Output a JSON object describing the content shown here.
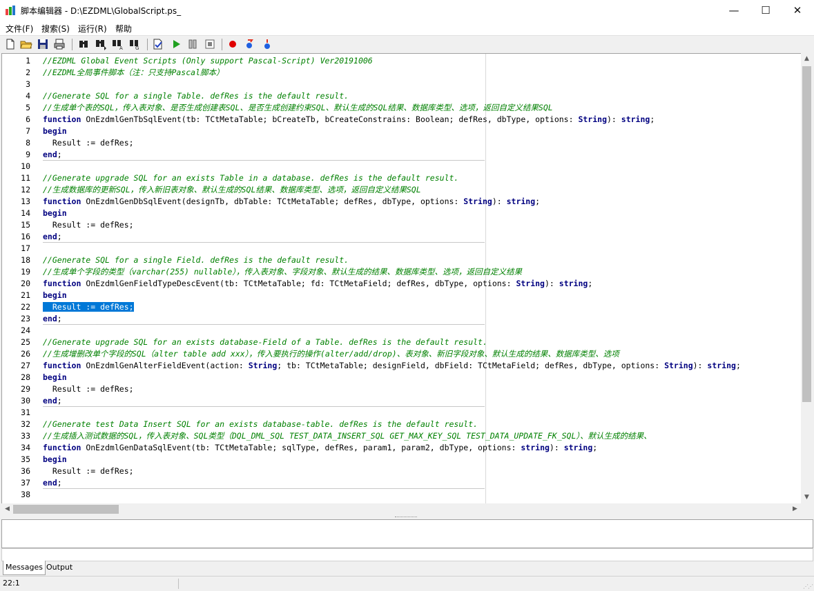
{
  "window": {
    "title": "脚本编辑器 - D:\\EZDML\\GlobalScript.ps_",
    "minimize_glyph": "—",
    "maximize_glyph": "☐",
    "close_glyph": "✕"
  },
  "menu": {
    "items": [
      {
        "label": "文件(F)"
      },
      {
        "label": "搜索(S)"
      },
      {
        "label": "运行(R)"
      },
      {
        "label": "帮助"
      }
    ]
  },
  "toolbar": {
    "buttons": [
      "new-file-icon",
      "open-folder-icon",
      "save-icon",
      "print-preview-icon",
      "find-icon",
      "find-next-icon",
      "replace-icon",
      "goto-line-icon",
      "syntax-check-icon",
      "run-icon",
      "pause-icon",
      "step-icon",
      "breakpoint-icon",
      "step-into-icon",
      "step-over-icon"
    ]
  },
  "editor": {
    "selected_line": 22,
    "lines": [
      {
        "n": "1",
        "segs": [
          {
            "t": "//EZDML Global Event Scripts (Only support Pascal-Script) Ver20191006",
            "c": "cmt"
          }
        ]
      },
      {
        "n": "2",
        "segs": [
          {
            "t": "//EZDML全局事件脚本（注：只支持Pascal脚本）",
            "c": "cmt"
          }
        ]
      },
      {
        "n": "3",
        "segs": []
      },
      {
        "n": "4",
        "segs": [
          {
            "t": "//Generate SQL for a single Table. defRes is the default result.",
            "c": "cmt"
          }
        ]
      },
      {
        "n": "5",
        "segs": [
          {
            "t": "//生成单个表的SQL，传入表对象、是否生成创建表SQL、是否生成创建约束SQL、默认生成的SQL结果、数据库类型、选项，返回自定义结果SQL",
            "c": "cmt"
          }
        ]
      },
      {
        "n": "6",
        "segs": [
          {
            "t": "function",
            "c": "kw"
          },
          {
            "t": " OnEzdmlGenTbSqlEvent(tb: TCtMetaTable; bCreateTb, bCreateConstrains: Boolean; defRes, dbType, options: ",
            "c": ""
          },
          {
            "t": "String",
            "c": "kw"
          },
          {
            "t": "): ",
            "c": ""
          },
          {
            "t": "string",
            "c": "kw"
          },
          {
            "t": ";",
            "c": ""
          }
        ]
      },
      {
        "n": "7",
        "segs": [
          {
            "t": "begin",
            "c": "kw"
          }
        ]
      },
      {
        "n": "8",
        "segs": [
          {
            "t": "  Result := defRes;",
            "c": ""
          }
        ]
      },
      {
        "n": "9",
        "segs": [
          {
            "t": "end",
            "c": "kw"
          },
          {
            "t": ";",
            "c": ""
          }
        ]
      },
      {
        "n": "10",
        "segs": []
      },
      {
        "n": "11",
        "segs": [
          {
            "t": "//Generate upgrade SQL for an exists Table in a database. defRes is the default result.",
            "c": "cmt"
          }
        ]
      },
      {
        "n": "12",
        "segs": [
          {
            "t": "//生成数据库的更新SQL，传入新旧表对象、默认生成的SQL结果、数据库类型、选项，返回自定义结果SQL",
            "c": "cmt"
          }
        ]
      },
      {
        "n": "13",
        "segs": [
          {
            "t": "function",
            "c": "kw"
          },
          {
            "t": " OnEzdmlGenDbSqlEvent(designTb, dbTable: TCtMetaTable; defRes, dbType, options: ",
            "c": ""
          },
          {
            "t": "String",
            "c": "kw"
          },
          {
            "t": "): ",
            "c": ""
          },
          {
            "t": "string",
            "c": "kw"
          },
          {
            "t": ";",
            "c": ""
          }
        ]
      },
      {
        "n": "14",
        "segs": [
          {
            "t": "begin",
            "c": "kw"
          }
        ]
      },
      {
        "n": "15",
        "segs": [
          {
            "t": "  Result := defRes;",
            "c": ""
          }
        ]
      },
      {
        "n": "16",
        "segs": [
          {
            "t": "end",
            "c": "kw"
          },
          {
            "t": ";",
            "c": ""
          }
        ]
      },
      {
        "n": "17",
        "segs": []
      },
      {
        "n": "18",
        "segs": [
          {
            "t": "//Generate SQL for a single Field. defRes is the default result.",
            "c": "cmt"
          }
        ]
      },
      {
        "n": "19",
        "segs": [
          {
            "t": "//生成单个字段的类型（varchar(255) nullable），传入表对象、字段对象、默认生成的结果、数据库类型、选项，返回自定义结果",
            "c": "cmt"
          }
        ]
      },
      {
        "n": "20",
        "segs": [
          {
            "t": "function",
            "c": "kw"
          },
          {
            "t": " OnEzdmlGenFieldTypeDescEvent(tb: TCtMetaTable; fd: TCtMetaField; defRes, dbType, options: ",
            "c": ""
          },
          {
            "t": "String",
            "c": "kw"
          },
          {
            "t": "): ",
            "c": ""
          },
          {
            "t": "string",
            "c": "kw"
          },
          {
            "t": ";",
            "c": ""
          }
        ]
      },
      {
        "n": "21",
        "segs": [
          {
            "t": "begin",
            "c": "kw"
          }
        ]
      },
      {
        "n": "22",
        "segs": [
          {
            "t": "  Result := defRes;",
            "c": "sel"
          }
        ]
      },
      {
        "n": "23",
        "segs": [
          {
            "t": "end",
            "c": "kw"
          },
          {
            "t": ";",
            "c": ""
          }
        ]
      },
      {
        "n": "24",
        "segs": []
      },
      {
        "n": "25",
        "segs": [
          {
            "t": "//Generate upgrade SQL for an exists database-Field of a Table. defRes is the default result.",
            "c": "cmt"
          }
        ]
      },
      {
        "n": "26",
        "segs": [
          {
            "t": "//生成增删改单个字段的SQL（alter table add xxx），传入要执行的操作(alter/add/drop)、表对象、新旧字段对象、默认生成的结果、数据库类型、选项",
            "c": "cmt"
          }
        ]
      },
      {
        "n": "27",
        "segs": [
          {
            "t": "function",
            "c": "kw"
          },
          {
            "t": " OnEzdmlGenAlterFieldEvent(action: ",
            "c": ""
          },
          {
            "t": "String",
            "c": "kw"
          },
          {
            "t": "; tb: TCtMetaTable; designField, dbField: TCtMetaField; defRes, dbType, options: ",
            "c": ""
          },
          {
            "t": "String",
            "c": "kw"
          },
          {
            "t": "): ",
            "c": ""
          },
          {
            "t": "string",
            "c": "kw"
          },
          {
            "t": ";",
            "c": ""
          }
        ]
      },
      {
        "n": "28",
        "segs": [
          {
            "t": "begin",
            "c": "kw"
          }
        ]
      },
      {
        "n": "29",
        "segs": [
          {
            "t": "  Result := defRes;",
            "c": ""
          }
        ]
      },
      {
        "n": "30",
        "segs": [
          {
            "t": "end",
            "c": "kw"
          },
          {
            "t": ";",
            "c": ""
          }
        ]
      },
      {
        "n": "31",
        "segs": []
      },
      {
        "n": "32",
        "segs": [
          {
            "t": "//Generate test Data Insert SQL for an exists database-table. defRes is the default result.",
            "c": "cmt"
          }
        ]
      },
      {
        "n": "33",
        "segs": [
          {
            "t": "//生成插入测试数据的SQL，传入表对象、SQL类型（DQL_DML_SQL TEST_DATA_INSERT_SQL GET_MAX_KEY_SQL TEST_DATA_UPDATE_FK_SQL）、默认生成的结果、",
            "c": "cmt"
          }
        ]
      },
      {
        "n": "34",
        "segs": [
          {
            "t": "function",
            "c": "kw"
          },
          {
            "t": " OnEzdmlGenDataSqlEvent(tb: TCtMetaTable; sqlType, defRes, param1, param2, dbType, options: ",
            "c": ""
          },
          {
            "t": "string",
            "c": "kw"
          },
          {
            "t": "): ",
            "c": ""
          },
          {
            "t": "string",
            "c": "kw"
          },
          {
            "t": ";",
            "c": ""
          }
        ]
      },
      {
        "n": "35",
        "segs": [
          {
            "t": "begin",
            "c": "kw"
          }
        ]
      },
      {
        "n": "36",
        "segs": [
          {
            "t": "  Result := defRes;",
            "c": ""
          }
        ]
      },
      {
        "n": "37",
        "segs": [
          {
            "t": "end",
            "c": "kw"
          },
          {
            "t": ";",
            "c": ""
          }
        ]
      },
      {
        "n": "38",
        "segs": []
      }
    ]
  },
  "bottom_tabs": [
    {
      "label": "Messages",
      "active": true
    },
    {
      "label": "Output",
      "active": false
    }
  ],
  "status": {
    "cursor": "22:1"
  }
}
